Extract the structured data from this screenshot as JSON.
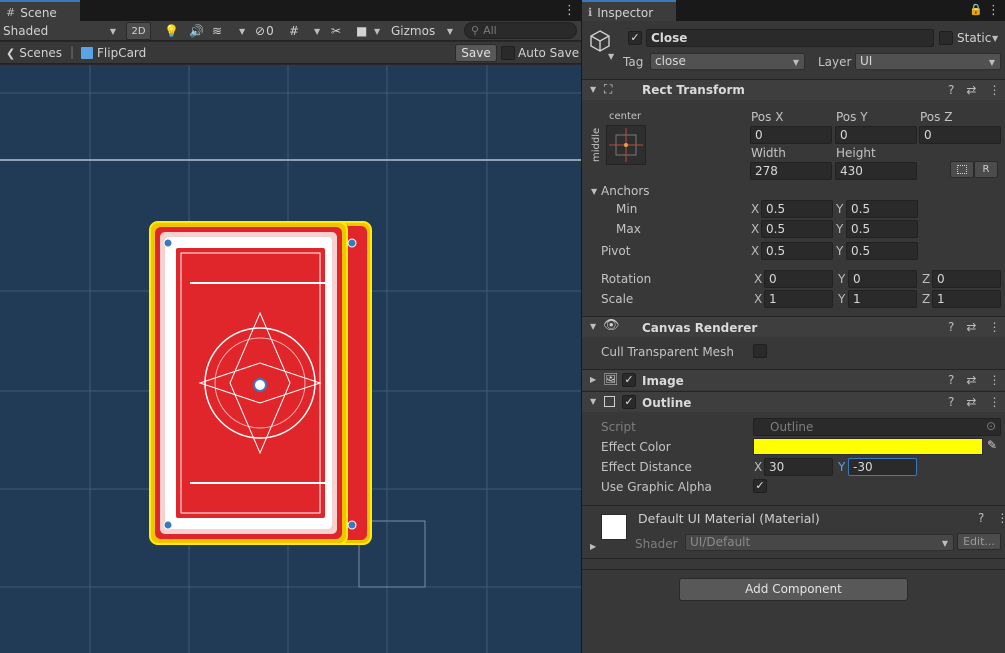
{
  "scene": {
    "tab_label": "Scene",
    "toolbar": {
      "shading_mode": "Shaded",
      "mode_2d": "2D",
      "hidden_count": "0",
      "gizmos": "Gizmos",
      "search_placeholder": "All"
    },
    "breadcrumb": {
      "scenes": "Scenes",
      "prefab": "FlipCard"
    },
    "save_label": "Save",
    "auto_save_label": "Auto Save"
  },
  "inspector": {
    "tab_label": "Inspector",
    "object": {
      "name": "Close",
      "static_label": "Static",
      "tag_label": "Tag",
      "tag_value": "close",
      "layer_label": "Layer",
      "layer_value": "UI",
      "active": true
    },
    "rect_transform": {
      "title": "Rect Transform",
      "anchor_preset_top": "center",
      "anchor_preset_side": "middle",
      "pos_x_label": "Pos X",
      "pos_x": "0",
      "pos_y_label": "Pos Y",
      "pos_y": "0",
      "pos_z_label": "Pos Z",
      "pos_z": "0",
      "width_label": "Width",
      "width": "278",
      "height_label": "Height",
      "height": "430",
      "r_button": "R",
      "anchors_label": "Anchors",
      "min_label": "Min",
      "min_x": "0.5",
      "min_y": "0.5",
      "max_label": "Max",
      "max_x": "0.5",
      "max_y": "0.5",
      "pivot_label": "Pivot",
      "pivot_x": "0.5",
      "pivot_y": "0.5",
      "rotation_label": "Rotation",
      "rot_x": "0",
      "rot_y": "0",
      "rot_z": "0",
      "scale_label": "Scale",
      "scale_x": "1",
      "scale_y": "1",
      "scale_z": "1",
      "x": "X",
      "y": "Y",
      "z": "Z"
    },
    "canvas_renderer": {
      "title": "Canvas Renderer",
      "cull_label": "Cull Transparent Mesh",
      "cull_value": false
    },
    "image": {
      "title": "Image",
      "enabled": true
    },
    "outline": {
      "title": "Outline",
      "enabled": true,
      "script_label": "Script",
      "script_value": "Outline",
      "effect_color_label": "Effect Color",
      "effect_color": "#ffff00",
      "effect_distance_label": "Effect Distance",
      "distance_x": "30",
      "distance_y": "-30",
      "use_graphic_alpha_label": "Use Graphic Alpha",
      "use_graphic_alpha": true
    },
    "material": {
      "title": "Default UI Material (Material)",
      "shader_label": "Shader",
      "shader_value": "UI/Default",
      "edit_button": "Edit..."
    },
    "add_component": "Add Component"
  },
  "colors": {
    "accent": "#3a79bb",
    "card_red": "#e0262a",
    "card_yellow": "#ffee00",
    "scene_bg": "#213a56"
  }
}
